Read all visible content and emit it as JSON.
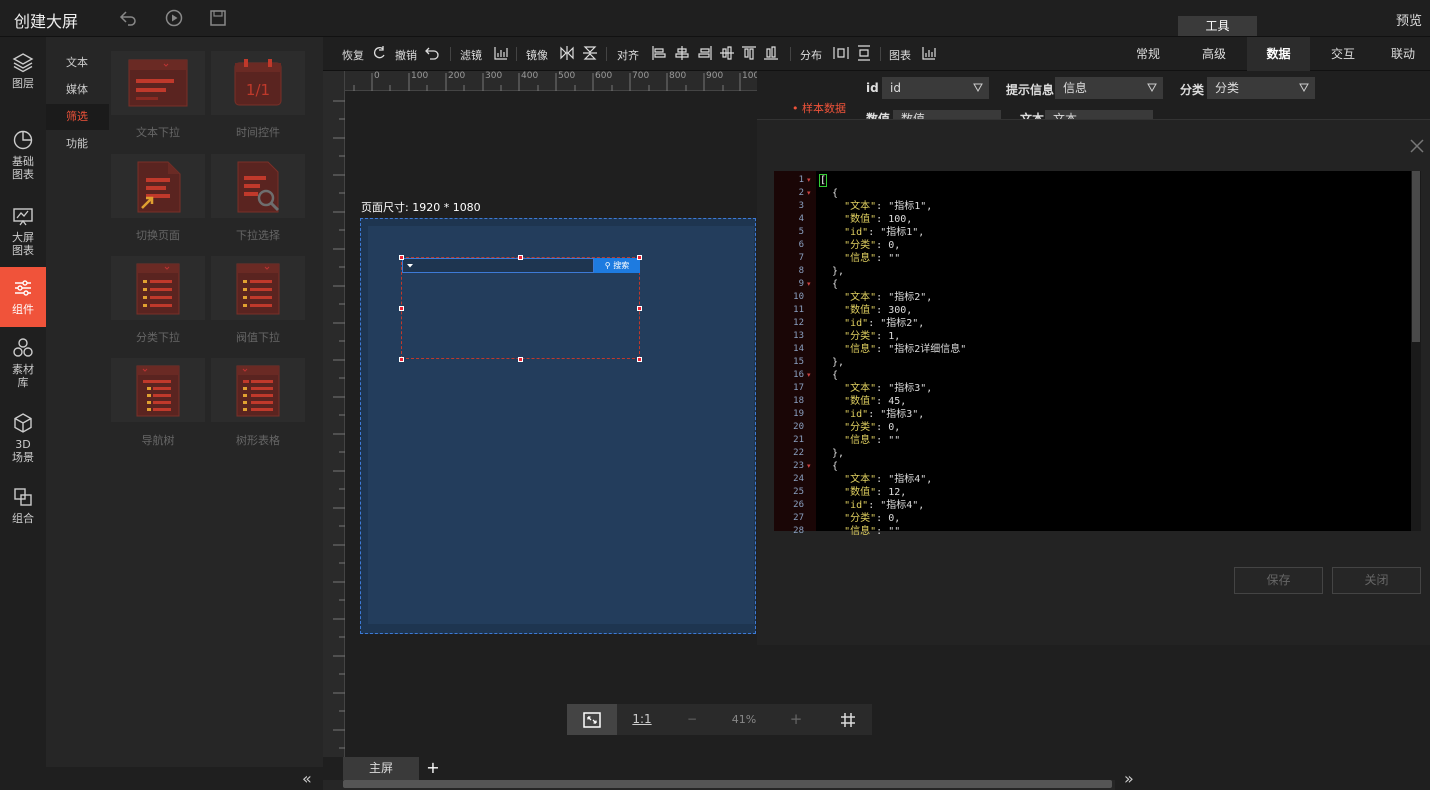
{
  "header": {
    "title": "创建大屏",
    "preview": "预览",
    "tool_tab": "工具"
  },
  "leftnav": [
    {
      "label": "图层",
      "icon": "layers-icon"
    },
    {
      "label": "基础图表",
      "icon": "pie-chart-icon"
    },
    {
      "label": "大屏图表",
      "icon": "screen-chart-icon"
    },
    {
      "label": "组件",
      "icon": "sliders-icon",
      "active": true
    },
    {
      "label": "素材库",
      "icon": "material-icon"
    },
    {
      "label": "3D场景",
      "icon": "cube-icon"
    },
    {
      "label": "组合",
      "icon": "group-icon"
    }
  ],
  "subnav": [
    "文本",
    "媒体",
    "筛选",
    "功能"
  ],
  "components": [
    {
      "label": "文本下拉",
      "icon": "text-dropdown-icon"
    },
    {
      "label": "时间控件",
      "icon": "calendar-icon"
    },
    {
      "label": "切换页面",
      "icon": "switch-page-icon"
    },
    {
      "label": "下拉选择",
      "icon": "dropdown-search-icon"
    },
    {
      "label": "分类下拉",
      "icon": "category-dropdown-icon"
    },
    {
      "label": "阀值下拉",
      "icon": "threshold-dropdown-icon"
    },
    {
      "label": "导航树",
      "icon": "nav-tree-icon"
    },
    {
      "label": "树形表格",
      "icon": "tree-table-icon"
    }
  ],
  "toolbar": {
    "redo": "恢复",
    "undo": "撤销",
    "filter": "滤镜",
    "mirror": "镜像",
    "align": "对齐",
    "distribute": "分布",
    "chart": "图表"
  },
  "ruler_ticks": [
    "0",
    "100",
    "200",
    "300",
    "400",
    "500",
    "600",
    "700",
    "800",
    "900",
    "100"
  ],
  "canvas": {
    "page_size": "页面尺寸: 1920 * 1080",
    "search_btn": "搜索"
  },
  "zoom": {
    "fit": "fit-screen-icon",
    "one_to_one": "1:1",
    "minus": "−",
    "level": "41%",
    "plus": "+",
    "grid": "grid-icon"
  },
  "pages": {
    "main": "主屏",
    "add": "+"
  },
  "right_tabs": [
    "常规",
    "高级",
    "数据",
    "交互",
    "联动"
  ],
  "data_config": {
    "id_label": "id",
    "id_value": "id",
    "tip_label": "提示信息",
    "tip_value": "信息",
    "category_label": "分类",
    "category_value": "分类",
    "sample_label": "样本数据",
    "row2_label1": "数值",
    "row2_value1": "数值",
    "row2_label2": "文本",
    "row2_value2": "文本"
  },
  "modal": {
    "save": "保存",
    "close": "关闭"
  },
  "json_lines": [
    "[",
    "  {",
    "    \"文本\": \"指标1\",",
    "    \"数值\": 100,",
    "    \"id\": \"指标1\",",
    "    \"分类\": 0,",
    "    \"信息\": \"\"",
    "  },",
    "  {",
    "    \"文本\": \"指标2\",",
    "    \"数值\": 300,",
    "    \"id\": \"指标2\",",
    "    \"分类\": 1,",
    "    \"信息\": \"指标2详细信息\"",
    "  },",
    "  {",
    "    \"文本\": \"指标3\",",
    "    \"数值\": 45,",
    "    \"id\": \"指标3\",",
    "    \"分类\": 0,",
    "    \"信息\": \"\"",
    "  },",
    "  {",
    "    \"文本\": \"指标4\",",
    "    \"数值\": 12,",
    "    \"id\": \"指标4\",",
    "    \"分类\": 0,",
    "    \"信息\": \"\""
  ],
  "colors": {
    "accent": "#f0533a",
    "blue": "#1e7be0",
    "canvas": "#1e3550"
  }
}
